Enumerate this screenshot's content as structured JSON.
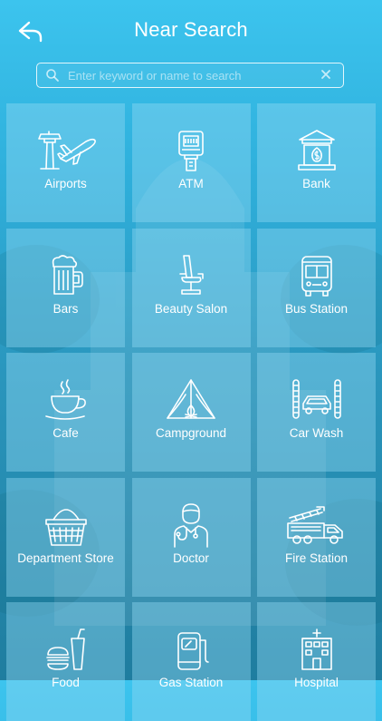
{
  "header": {
    "title": "Near Search",
    "back_icon": "back-arrow-icon"
  },
  "search": {
    "placeholder": "Enter keyword or name to search",
    "value": "",
    "search_icon": "search-icon",
    "clear_icon": "close-icon"
  },
  "categories": [
    {
      "label": "Airports",
      "icon": "airport-icon"
    },
    {
      "label": "ATM",
      "icon": "atm-icon"
    },
    {
      "label": "Bank",
      "icon": "bank-icon"
    },
    {
      "label": "Bars",
      "icon": "beer-mug-icon"
    },
    {
      "label": "Beauty Salon",
      "icon": "salon-chair-icon"
    },
    {
      "label": "Bus Station",
      "icon": "bus-icon"
    },
    {
      "label": "Cafe",
      "icon": "coffee-cup-icon"
    },
    {
      "label": "Campground",
      "icon": "tent-icon"
    },
    {
      "label": "Car Wash",
      "icon": "car-wash-icon"
    },
    {
      "label": "Department Store",
      "icon": "basket-icon"
    },
    {
      "label": "Doctor",
      "icon": "doctor-icon"
    },
    {
      "label": "Fire Station",
      "icon": "fire-truck-icon"
    },
    {
      "label": "Food",
      "icon": "fast-food-icon"
    },
    {
      "label": "Gas Station",
      "icon": "gas-pump-icon"
    },
    {
      "label": "Hospital",
      "icon": "hospital-icon"
    }
  ],
  "colors": {
    "background_top": "#3cc4ee",
    "background_bottom": "#1f7d9f",
    "tile": "#91daf2",
    "foreground": "#ffffff"
  }
}
